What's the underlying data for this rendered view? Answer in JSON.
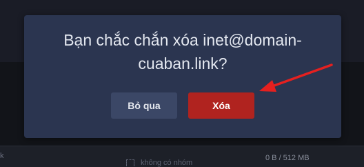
{
  "dialog": {
    "message_line1": "Bạn chắc chắn xóa inet@domain-",
    "message_line2": "cuaban.link?",
    "cancel_label": "Bỏ qua",
    "delete_label": "Xóa"
  },
  "background": {
    "left_mark": "k",
    "group_text": "không có nhóm",
    "storage_text": "0 B / 512 MB"
  },
  "colors": {
    "dialog_bg": "#2b3550",
    "delete_button": "#b0231f",
    "cancel_button": "#3b4766",
    "annotation_arrow": "#e5201f"
  },
  "icons": {
    "annotation": "red-arrow-icon",
    "group": "group-icon"
  }
}
